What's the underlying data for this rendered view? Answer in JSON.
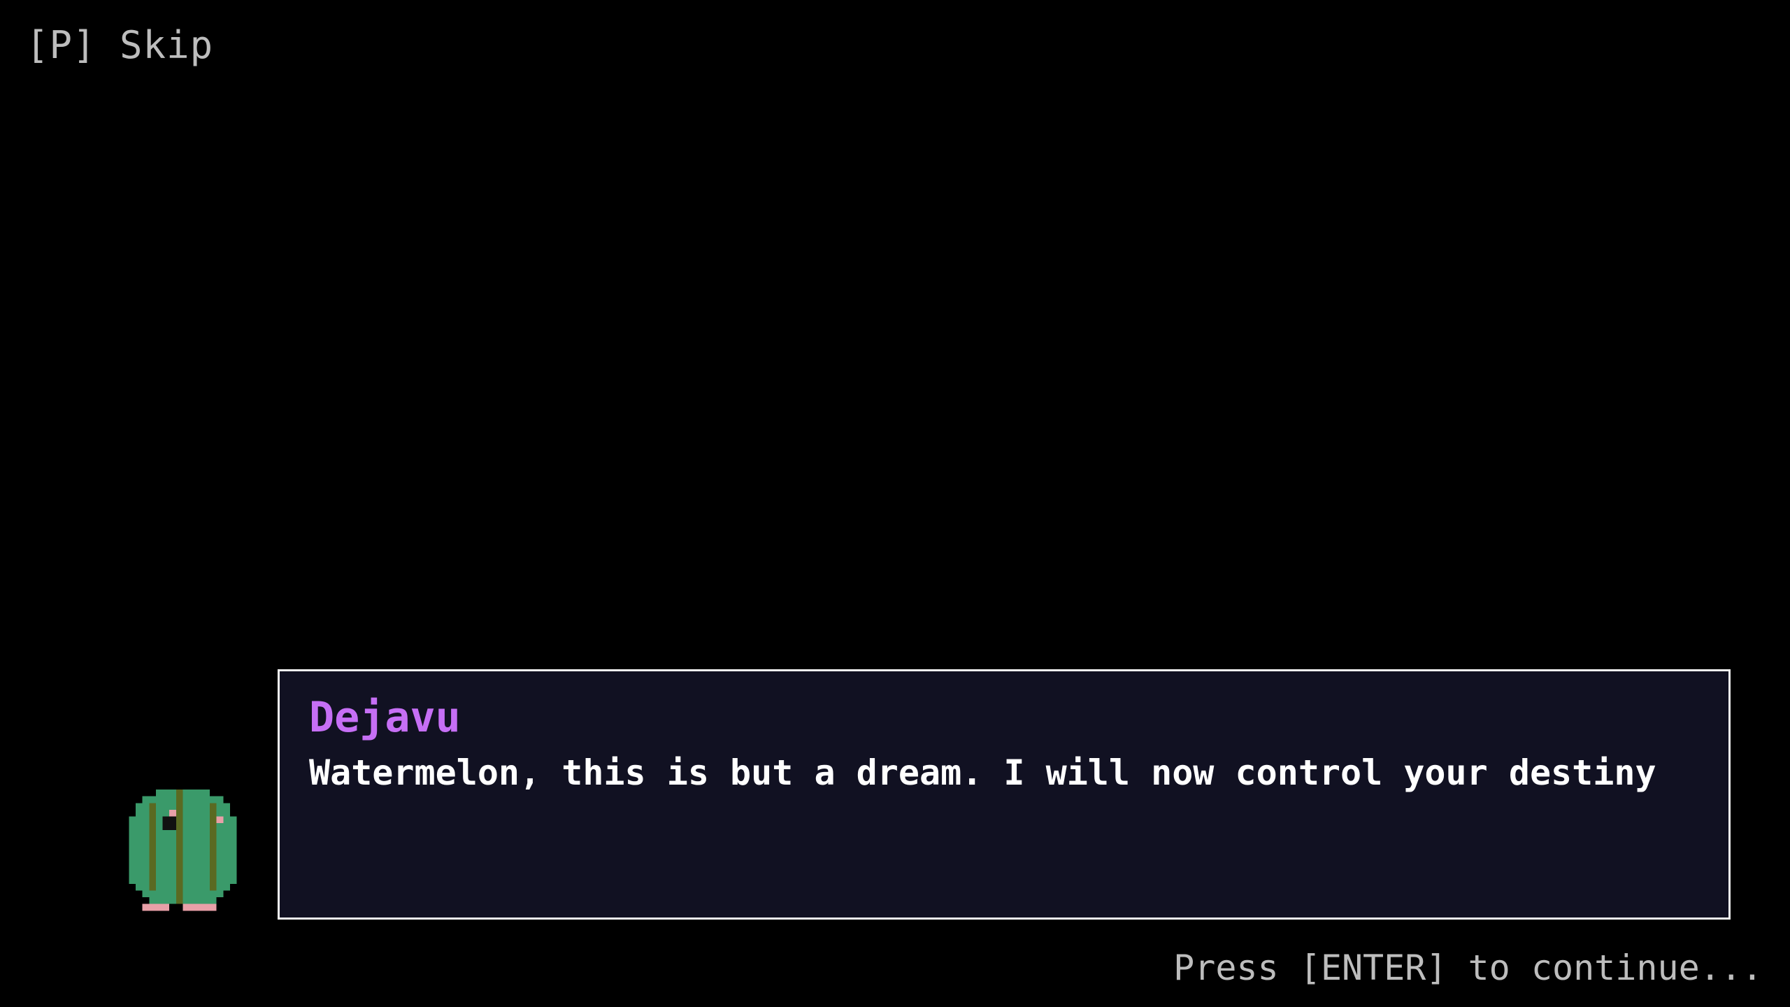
{
  "skip_hint": "[P] Skip",
  "dialog": {
    "speaker": "Dejavu",
    "speaker_color": "#c66ff5",
    "text": "Watermelon, this is but a dream. I will now control your destiny"
  },
  "continue_hint": "Press [ENTER] to continue...",
  "character": {
    "icon": "watermelon-character-icon",
    "body_color": "#3a9a6a",
    "stripe_color": "#5a6a22",
    "feet_color": "#e8a0a8"
  },
  "colors": {
    "background": "#000000",
    "dialog_bg": "#111122",
    "dialog_border": "#f2f2f2",
    "text": "#ffffff",
    "hint": "#bdbdbd"
  }
}
